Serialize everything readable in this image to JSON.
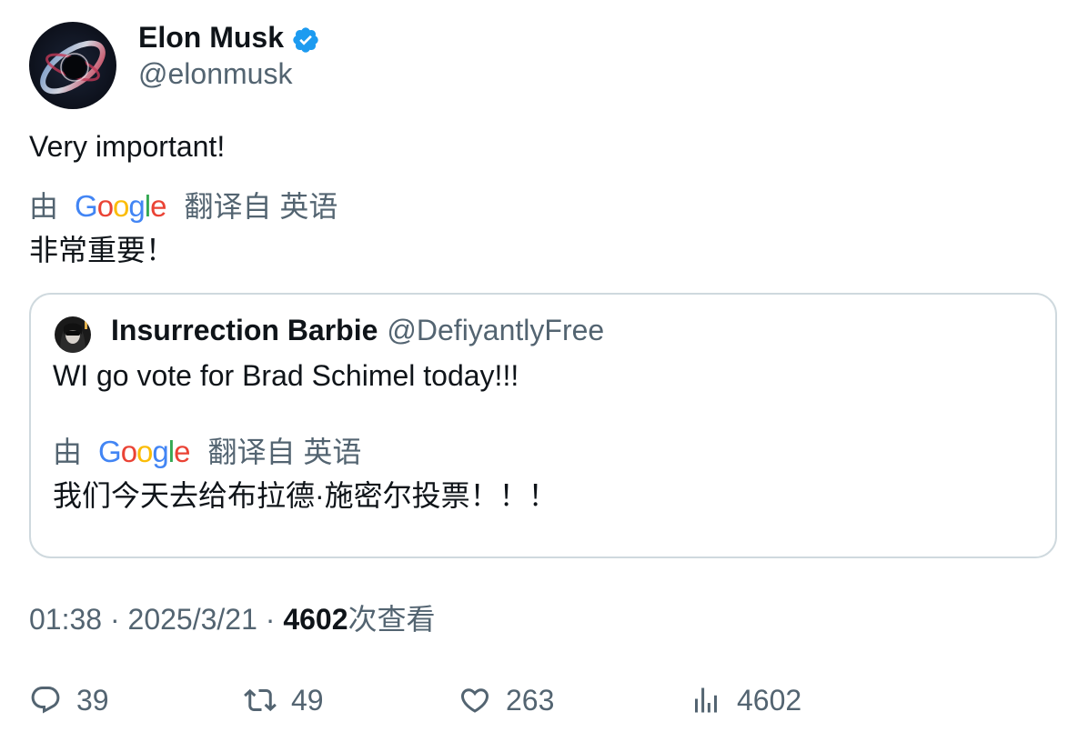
{
  "author": {
    "name": "Elon Musk",
    "handle": "@elonmusk",
    "verified_color": "#1D9BF0"
  },
  "tweet": {
    "text": "Very important!",
    "translation": {
      "prefix": "由",
      "source": "翻译自 英语",
      "text": "非常重要！"
    }
  },
  "google_logo": {
    "letters": [
      "G",
      "o",
      "o",
      "g",
      "l",
      "e"
    ],
    "colors": [
      "#4285F4",
      "#EA4335",
      "#FBBC05",
      "#4285F4",
      "#34A853",
      "#EA4335"
    ]
  },
  "quote": {
    "name": "Insurrection Barbie",
    "handle": "@DefiyantlyFree",
    "text": "WI go vote for Brad Schimel today!!!",
    "translation": {
      "prefix": "由",
      "source": "翻译自 英语",
      "text": "我们今天去给布拉德·施密尔投票！！！"
    }
  },
  "meta": {
    "time_date": "01:38 · 2025/3/21 · ",
    "views_count": "4602",
    "views_suffix": "次查看"
  },
  "actions": {
    "reply": "39",
    "repost": "49",
    "like": "263",
    "views": "4602"
  },
  "icons": {
    "reply": "reply-icon",
    "repost": "repost-icon",
    "like": "heart-icon",
    "views": "views-chart-icon",
    "verified": "verified-badge-icon"
  }
}
